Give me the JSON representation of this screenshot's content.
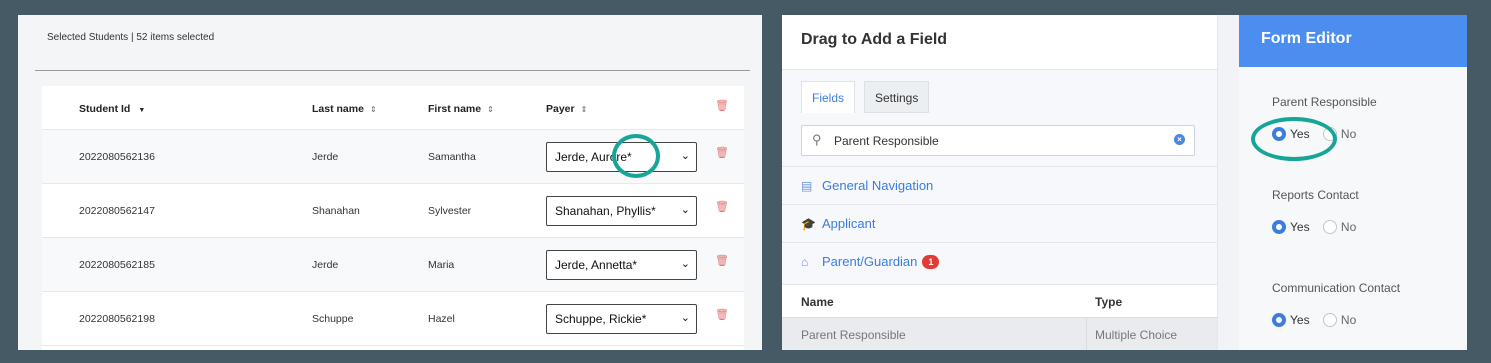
{
  "left_panel": {
    "caption": "Selected Students | 52 items selected",
    "columns": {
      "student_id": "Student Id",
      "last_name": "Last name",
      "first_name": "First name",
      "payer": "Payer"
    },
    "rows": [
      {
        "id": "2022080562136",
        "last": "Jerde",
        "first": "Samantha",
        "payer": "Jerde, Aurore*"
      },
      {
        "id": "2022080562147",
        "last": "Shanahan",
        "first": "Sylvester",
        "payer": "Shanahan, Phyllis*"
      },
      {
        "id": "2022080562185",
        "last": "Jerde",
        "first": "Maria",
        "payer": "Jerde, Annetta*"
      },
      {
        "id": "2022080562198",
        "last": "Schuppe",
        "first": "Hazel",
        "payer": "Schuppe, Rickie*"
      }
    ]
  },
  "drag_panel": {
    "title": "Drag to Add a Field",
    "tabs": {
      "fields": "Fields",
      "settings": "Settings"
    },
    "search": {
      "value": "Parent Responsible"
    },
    "nav": {
      "general": "General Navigation",
      "applicant": "Applicant",
      "parent": "Parent/Guardian",
      "parent_badge": "1"
    },
    "table": {
      "name_header": "Name",
      "type_header": "Type",
      "row_name": "Parent Responsible",
      "row_type": "Multiple Choice"
    }
  },
  "form_editor": {
    "title": "Form Editor",
    "yes": "Yes",
    "no": "No",
    "fields": {
      "parent_responsible": "Parent Responsible",
      "reports_contact": "Reports Contact",
      "communication_contact": "Communication Contact"
    }
  },
  "colors": {
    "accent_blue": "#4b8ef0",
    "annotation_ring": "#16a596",
    "delete_icon": "#e57373",
    "badge_red": "#e53935"
  },
  "icons": [
    "sort-desc-icon",
    "sort-icon",
    "trash-icon",
    "chevron-down-icon",
    "search-icon",
    "clear-icon",
    "document-icon",
    "graduation-cap-icon",
    "home-icon"
  ]
}
